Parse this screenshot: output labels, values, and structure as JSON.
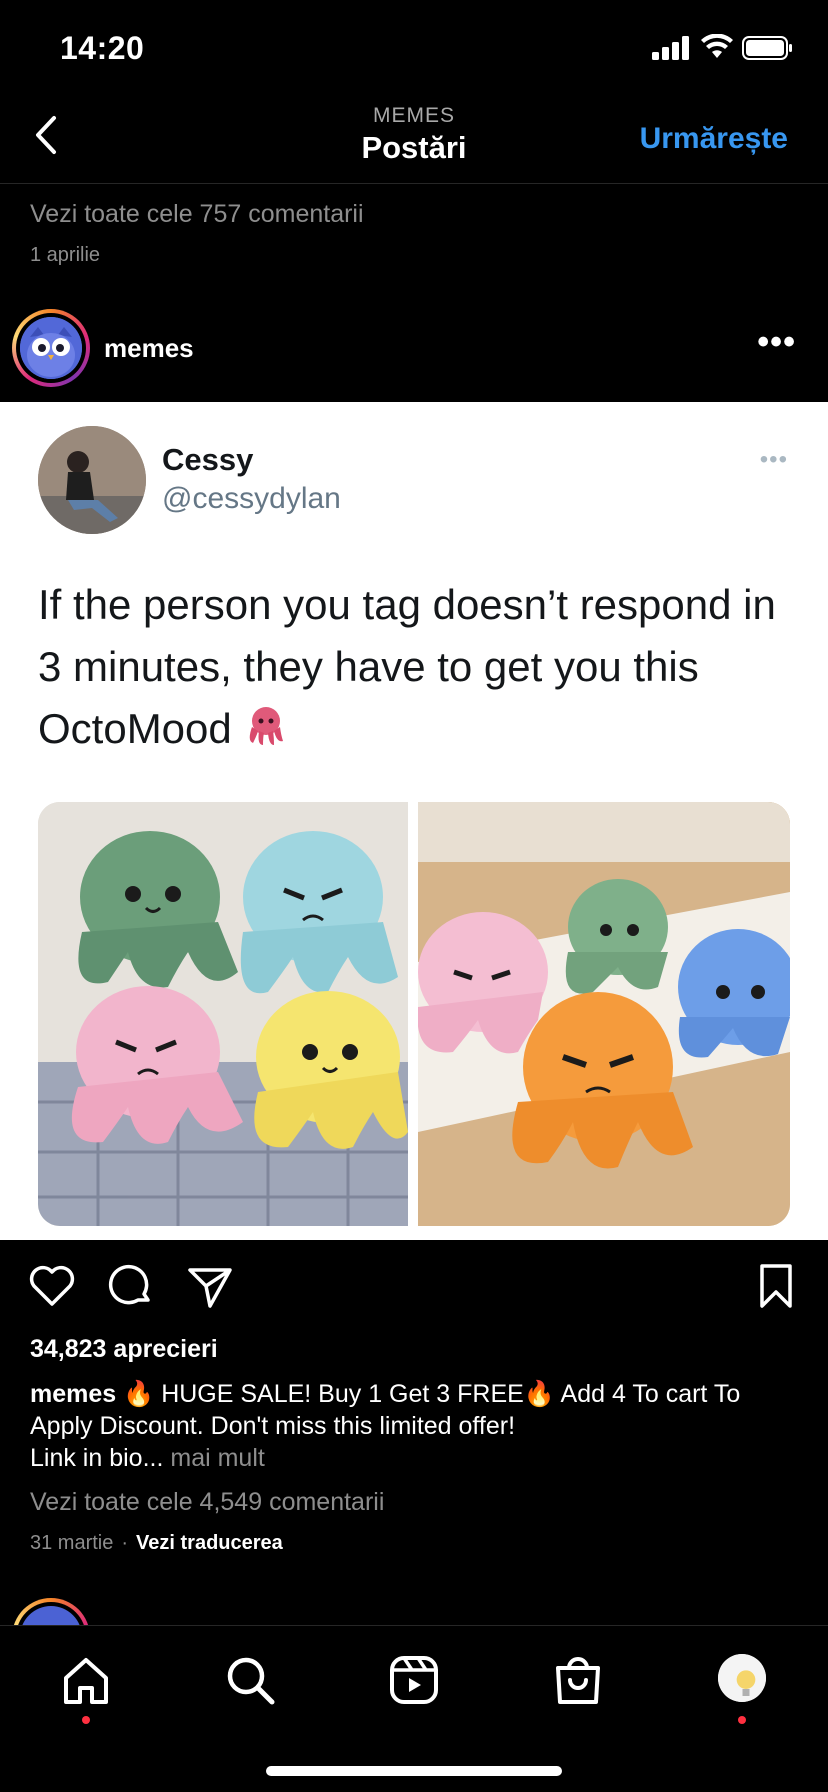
{
  "status_bar": {
    "time": "14:20"
  },
  "nav": {
    "supertitle": "MEMES",
    "title": "Postări",
    "follow_label": "Urmărește"
  },
  "previous_post": {
    "comments_link": "Vezi toate cele 757 comentarii",
    "date": "1 aprilie"
  },
  "post": {
    "username": "memes",
    "more": "•••",
    "tweet": {
      "name": "Cessy",
      "handle": "@cessydylan",
      "more": "•••",
      "text": "If the person you tag doesn’t respond in 3 minutes, they have to get you this OctoMood",
      "emoji": "octopus-emoji"
    },
    "likes": "34,823 aprecieri",
    "caption": {
      "username": "memes",
      "text_1": " 🔥 HUGE SALE! Buy 1 Get 3 FREE",
      "text_2": "🔥 Add 4 To cart To Apply Discount. Don't miss this limited offer!",
      "text_3": "Link in bio...",
      "more_label": " mai mult"
    },
    "comments_link": "Vezi toate cele 4,549 comentarii",
    "date": "31 martie",
    "separator": "·",
    "translate_label": "Vezi traducerea"
  },
  "tabbar": {
    "items": [
      {
        "icon": "home-icon",
        "badge": true
      },
      {
        "icon": "search-icon",
        "badge": false
      },
      {
        "icon": "reels-icon",
        "badge": false
      },
      {
        "icon": "shop-icon",
        "badge": false
      },
      {
        "icon": "profile-avatar",
        "badge": true
      }
    ]
  },
  "colors": {
    "accent": "#3897f0",
    "background": "#000000",
    "secondary_text": "#8e8e8e",
    "badge": "#ff3040"
  }
}
